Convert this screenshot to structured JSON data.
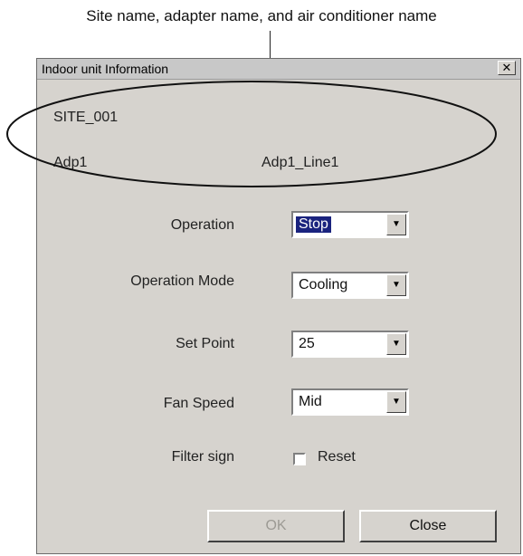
{
  "annotation": {
    "caption": "Site name, adapter name, and air conditioner name"
  },
  "window": {
    "title": "Indoor unit Information",
    "close_glyph": "✕"
  },
  "info": {
    "site": "SITE_001",
    "adapter": "Adp1",
    "air_conditioner": "Adp1_Line1"
  },
  "fields": {
    "operation": {
      "label": "Operation",
      "value": "Stop"
    },
    "mode": {
      "label": "Operation Mode",
      "value": "Cooling"
    },
    "set_point": {
      "label": "Set Point",
      "value": "25"
    },
    "fan_speed": {
      "label": "Fan Speed",
      "value": "Mid"
    },
    "filter_sign": {
      "label": "Filter sign",
      "checkbox_label": "Reset",
      "checked": false
    }
  },
  "dropdown_glyph": "▼",
  "buttons": {
    "ok": "OK",
    "close": "Close"
  }
}
